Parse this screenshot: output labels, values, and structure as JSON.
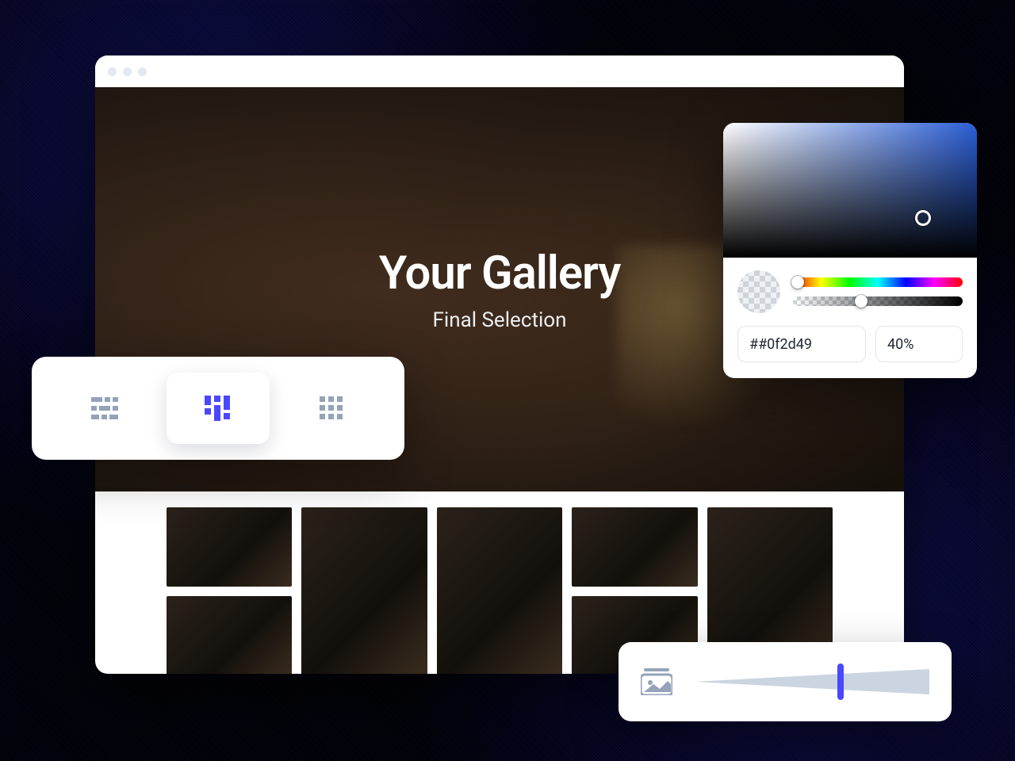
{
  "hero": {
    "title": "Your Gallery",
    "subtitle": "Final Selection"
  },
  "layout_panel": {
    "options": [
      "rows",
      "masonry",
      "grid"
    ],
    "active": "masonry"
  },
  "color_picker": {
    "hex": "##0f2d49",
    "alpha": "40%"
  },
  "colors": {
    "accent": "#4a47ff"
  }
}
